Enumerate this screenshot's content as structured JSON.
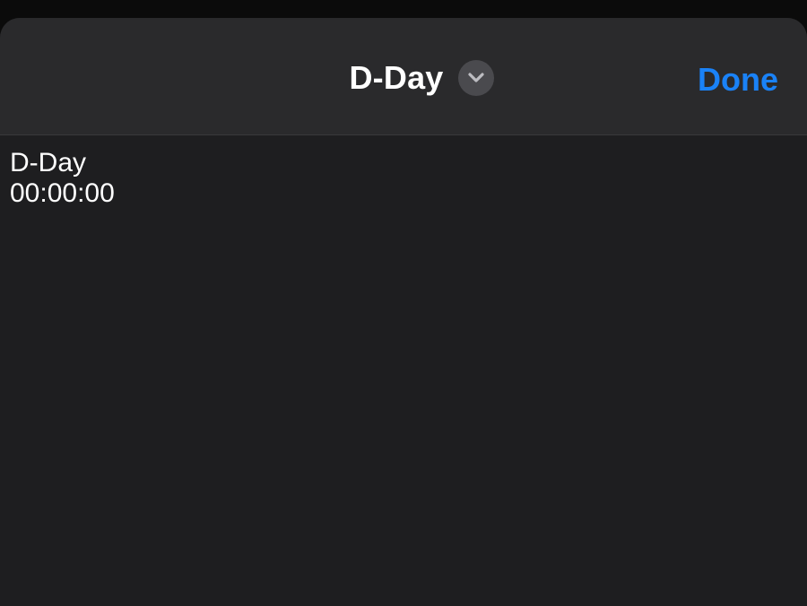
{
  "header": {
    "title": "D-Day",
    "dropdown_icon": "chevron-down-icon",
    "done_label": "Done"
  },
  "content": {
    "lines": [
      "D-Day",
      "00:00:00"
    ]
  },
  "colors": {
    "accent": "#1a82f7",
    "header_bg": "#2a2a2c",
    "body_bg": "#1e1e20"
  }
}
